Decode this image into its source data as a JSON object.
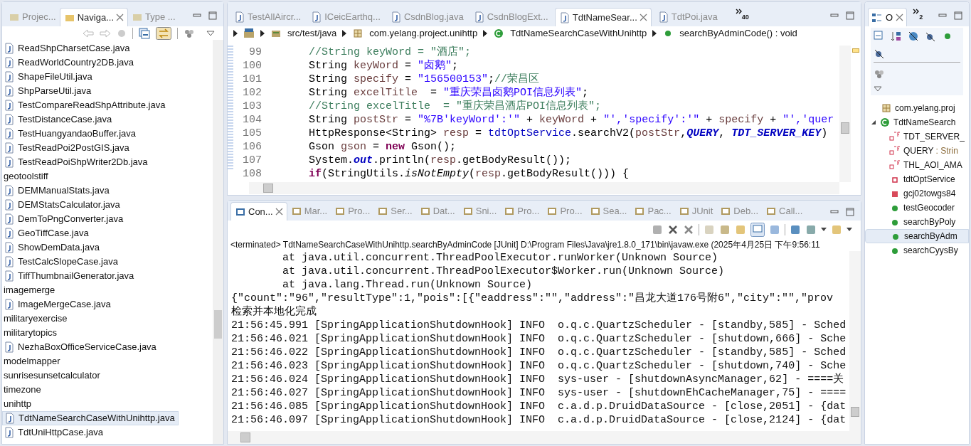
{
  "navigator": {
    "tabs": [
      {
        "label": "Projec...",
        "selected": false
      },
      {
        "label": "Naviga...",
        "selected": true
      },
      {
        "label": "Type ...",
        "selected": false
      }
    ],
    "items": [
      {
        "label": "ReadShpCharsetCase.java",
        "kind": "file",
        "selected": false
      },
      {
        "label": "ReadWorldCountry2DB.java",
        "kind": "file",
        "selected": false
      },
      {
        "label": "ShapeFileUtil.java",
        "kind": "file",
        "selected": false
      },
      {
        "label": "ShpParseUtil.java",
        "kind": "file",
        "selected": false
      },
      {
        "label": "TestCompareReadShpAttribute.java",
        "kind": "file",
        "selected": false
      },
      {
        "label": "TestDistanceCase.java",
        "kind": "file",
        "selected": false
      },
      {
        "label": "TestHuangyandaoBuffer.java",
        "kind": "file",
        "selected": false
      },
      {
        "label": "TestReadPoi2PostGIS.java",
        "kind": "file",
        "selected": false
      },
      {
        "label": "TestReadPoiShpWriter2Db.java",
        "kind": "file",
        "selected": false
      },
      {
        "label": "geotoolstiff",
        "kind": "folder",
        "selected": false
      },
      {
        "label": "DEMManualStats.java",
        "kind": "file",
        "selected": false
      },
      {
        "label": "DEMStatsCalculator.java",
        "kind": "file",
        "selected": false
      },
      {
        "label": "DemToPngConverter.java",
        "kind": "file",
        "selected": false
      },
      {
        "label": "GeoTiffCase.java",
        "kind": "file",
        "selected": false
      },
      {
        "label": "ShowDemData.java",
        "kind": "file",
        "selected": false
      },
      {
        "label": "TestCalcSlopeCase.java",
        "kind": "file",
        "selected": false
      },
      {
        "label": "TiffThumbnailGenerator.java",
        "kind": "file",
        "selected": false
      },
      {
        "label": "imagemerge",
        "kind": "folder",
        "selected": false
      },
      {
        "label": "ImageMergeCase.java",
        "kind": "file",
        "selected": false
      },
      {
        "label": "militaryexercise",
        "kind": "folder",
        "selected": false
      },
      {
        "label": "militarytopics",
        "kind": "folder",
        "selected": false
      },
      {
        "label": "NezhaBoxOfficeServiceCase.java",
        "kind": "file",
        "selected": false
      },
      {
        "label": "modelmapper",
        "kind": "folder",
        "selected": false
      },
      {
        "label": "sunrisesunsetcalculator",
        "kind": "folder",
        "selected": false
      },
      {
        "label": "timezone",
        "kind": "folder",
        "selected": false
      },
      {
        "label": "unihttp",
        "kind": "folder",
        "selected": false
      },
      {
        "label": "TdtNameSearchCaseWithUnihttp.java",
        "kind": "file",
        "selected": true
      },
      {
        "label": "TdtUniHttpCase.java",
        "kind": "file",
        "selected": false
      }
    ]
  },
  "editor": {
    "tabs": [
      {
        "label": "TestAllAircr...",
        "selected": false
      },
      {
        "label": "ICeicEarthq...",
        "selected": false
      },
      {
        "label": "CsdnBlog.java",
        "selected": false
      },
      {
        "label": "CsdnBlogExt...",
        "selected": false
      },
      {
        "label": "TdtNameSear...",
        "selected": true
      },
      {
        "label": "TdtPoi.java",
        "selected": false
      }
    ],
    "overflow": "40",
    "breadcrumb": [
      {
        "label": "src/test/java",
        "kind": "source"
      },
      {
        "label": "com.yelang.project.unihttp",
        "kind": "package"
      },
      {
        "label": "TdtNameSearchCaseWithUnihttp",
        "kind": "class"
      },
      {
        "label": "searchByAdminCode() : void",
        "kind": "method"
      }
    ],
    "lines": [
      {
        "number": "99",
        "tokens": [
          {
            "text": "//String keyWord = \"酒店\";",
            "kind": "comment"
          }
        ]
      },
      {
        "number": "100",
        "tokens": [
          {
            "text": "String ",
            "kind": "plain"
          },
          {
            "text": "keyWord",
            "kind": "local"
          },
          {
            "text": " = ",
            "kind": "plain"
          },
          {
            "text": "\"卤鹅\"",
            "kind": "string"
          },
          {
            "text": ";",
            "kind": "plain"
          }
        ]
      },
      {
        "number": "101",
        "tokens": [
          {
            "text": "String ",
            "kind": "plain"
          },
          {
            "text": "specify",
            "kind": "local"
          },
          {
            "text": " = ",
            "kind": "plain"
          },
          {
            "text": "\"156500153\"",
            "kind": "string"
          },
          {
            "text": ";",
            "kind": "plain"
          },
          {
            "text": "//荣昌区",
            "kind": "comment"
          }
        ]
      },
      {
        "number": "102",
        "tokens": [
          {
            "text": "String ",
            "kind": "plain"
          },
          {
            "text": "excelTitle",
            "kind": "local"
          },
          {
            "text": "  = ",
            "kind": "plain"
          },
          {
            "text": "\"重庆荣昌卤鹅POI信息列表\"",
            "kind": "string"
          },
          {
            "text": ";",
            "kind": "plain"
          }
        ]
      },
      {
        "number": "103",
        "tokens": [
          {
            "text": "//String excelTitle  = \"重庆荣昌酒店POI信息列表\";",
            "kind": "comment"
          }
        ]
      },
      {
        "number": "104",
        "tokens": [
          {
            "text": "String ",
            "kind": "plain"
          },
          {
            "text": "postStr",
            "kind": "local"
          },
          {
            "text": " = ",
            "kind": "plain"
          },
          {
            "text": "\"%7B'keyWord':'\"",
            "kind": "string"
          },
          {
            "text": " + ",
            "kind": "plain"
          },
          {
            "text": "keyWord",
            "kind": "local"
          },
          {
            "text": " + ",
            "kind": "plain"
          },
          {
            "text": "\"','specify':'\"",
            "kind": "string"
          },
          {
            "text": " + ",
            "kind": "plain"
          },
          {
            "text": "specify",
            "kind": "local"
          },
          {
            "text": " + ",
            "kind": "plain"
          },
          {
            "text": "\"','quer",
            "kind": "string"
          }
        ]
      },
      {
        "number": "105",
        "tokens": [
          {
            "text": "HttpResponse<String> ",
            "kind": "plain"
          },
          {
            "text": "resp",
            "kind": "local"
          },
          {
            "text": " = ",
            "kind": "plain"
          },
          {
            "text": "tdtOptService",
            "kind": "field"
          },
          {
            "text": ".searchV2(",
            "kind": "plain"
          },
          {
            "text": "postStr",
            "kind": "local"
          },
          {
            "text": ",",
            "kind": "plain"
          },
          {
            "text": "QUERY",
            "kind": "constant"
          },
          {
            "text": ", ",
            "kind": "plain"
          },
          {
            "text": "TDT_SERVER_KEY",
            "kind": "constant"
          },
          {
            "text": ")",
            "kind": "plain"
          }
        ]
      },
      {
        "number": "106",
        "tokens": [
          {
            "text": "Gson ",
            "kind": "plain"
          },
          {
            "text": "gson",
            "kind": "local"
          },
          {
            "text": " = ",
            "kind": "plain"
          },
          {
            "text": "new",
            "kind": "keyword"
          },
          {
            "text": " Gson();",
            "kind": "plain"
          }
        ]
      },
      {
        "number": "107",
        "tokens": [
          {
            "text": "System.",
            "kind": "plain"
          },
          {
            "text": "out",
            "kind": "constant"
          },
          {
            "text": ".println(",
            "kind": "plain"
          },
          {
            "text": "resp",
            "kind": "local"
          },
          {
            "text": ".getBodyResult());",
            "kind": "plain"
          }
        ]
      },
      {
        "number": "108",
        "tokens": [
          {
            "text": "if",
            "kind": "keyword"
          },
          {
            "text": "(StringUtils.",
            "kind": "plain"
          },
          {
            "text": "isNotEmpty",
            "kind": "static"
          },
          {
            "text": "(",
            "kind": "plain"
          },
          {
            "text": "resp",
            "kind": "local"
          },
          {
            "text": ".getBodyResult())) {",
            "kind": "plain"
          }
        ]
      }
    ]
  },
  "console": {
    "tabs": [
      {
        "label": "Con...",
        "selected": true
      },
      {
        "label": "Mar...",
        "selected": false
      },
      {
        "label": "Pro...",
        "selected": false
      },
      {
        "label": "Ser...",
        "selected": false
      },
      {
        "label": "Dat...",
        "selected": false
      },
      {
        "label": "Sni...",
        "selected": false
      },
      {
        "label": "Pro...",
        "selected": false
      },
      {
        "label": "Pro...",
        "selected": false
      },
      {
        "label": "Sea...",
        "selected": false
      },
      {
        "label": "Pac...",
        "selected": false
      },
      {
        "label": "JUnit",
        "selected": false
      },
      {
        "label": "Deb...",
        "selected": false
      },
      {
        "label": "Call...",
        "selected": false
      }
    ],
    "header": "<terminated> TdtNameSearchCaseWithUnihttp.searchByAdminCode [JUnit] D:\\Program Files\\Java\\jre1.8.0_171\\bin\\javaw.exe (2025年4月25日 下午9:56:11",
    "lines": [
      "        at java.util.concurrent.ThreadPoolExecutor.runWorker(Unknown Source)",
      "        at java.util.concurrent.ThreadPoolExecutor$Worker.run(Unknown Source)",
      "        at java.lang.Thread.run(Unknown Source)",
      "{\"count\":\"96\",\"resultType\":1,\"pois\":[{\"eaddress\":\"\",\"address\":\"昌龙大道176号附6\",\"city\":\"\",\"prov",
      "检索并本地化完成",
      "21:56:45.991 [SpringApplicationShutdownHook] INFO  o.q.c.QuartzScheduler - [standby,585] - Sched",
      "21:56:46.021 [SpringApplicationShutdownHook] INFO  o.q.c.QuartzScheduler - [shutdown,666] - Sche",
      "21:56:46.022 [SpringApplicationShutdownHook] INFO  o.q.c.QuartzScheduler - [standby,585] - Sched",
      "21:56:46.023 [SpringApplicationShutdownHook] INFO  o.q.c.QuartzScheduler - [shutdown,740] - Sche",
      "21:56:46.024 [SpringApplicationShutdownHook] INFO  sys-user - [shutdownAsyncManager,62] - ====关",
      "21:56:46.027 [SpringApplicationShutdownHook] INFO  sys-user - [shutdownEhCacheManager,75] - ====",
      "21:56:46.085 [SpringApplicationShutdownHook] INFO  c.a.d.p.DruidDataSource - [close,2051] - {dat",
      "21:56:46.097 [SpringApplicationShutdownHook] INFO  c.a.d.p.DruidDataSource - [close,2124] - {dat"
    ]
  },
  "outline": {
    "tab": "O",
    "overflow": "2",
    "items": [
      {
        "label": "com.yelang.proj",
        "kind": "package",
        "selected": false
      },
      {
        "label": "TdtNameSearch",
        "kind": "class",
        "selected": false,
        "expanded": true,
        "children": [
          {
            "label": "TDT_SERVER_",
            "kind": "constant",
            "selected": false
          },
          {
            "label": "QUERY",
            "type": ": Strin",
            "kind": "constant",
            "selected": false
          },
          {
            "label": "THL_AOI_AMA",
            "kind": "constant",
            "selected": false
          },
          {
            "label": "tdtOptService",
            "kind": "field",
            "selected": false
          },
          {
            "label": "gcj02towgs84",
            "kind": "private-method",
            "selected": false
          },
          {
            "label": "testGeocoder",
            "kind": "method",
            "selected": false
          },
          {
            "label": "searchByPoly",
            "kind": "method",
            "selected": false
          },
          {
            "label": "searchByAdm",
            "kind": "method",
            "selected": true
          },
          {
            "label": "searchCyysBy",
            "kind": "method",
            "selected": false
          }
        ]
      }
    ]
  }
}
